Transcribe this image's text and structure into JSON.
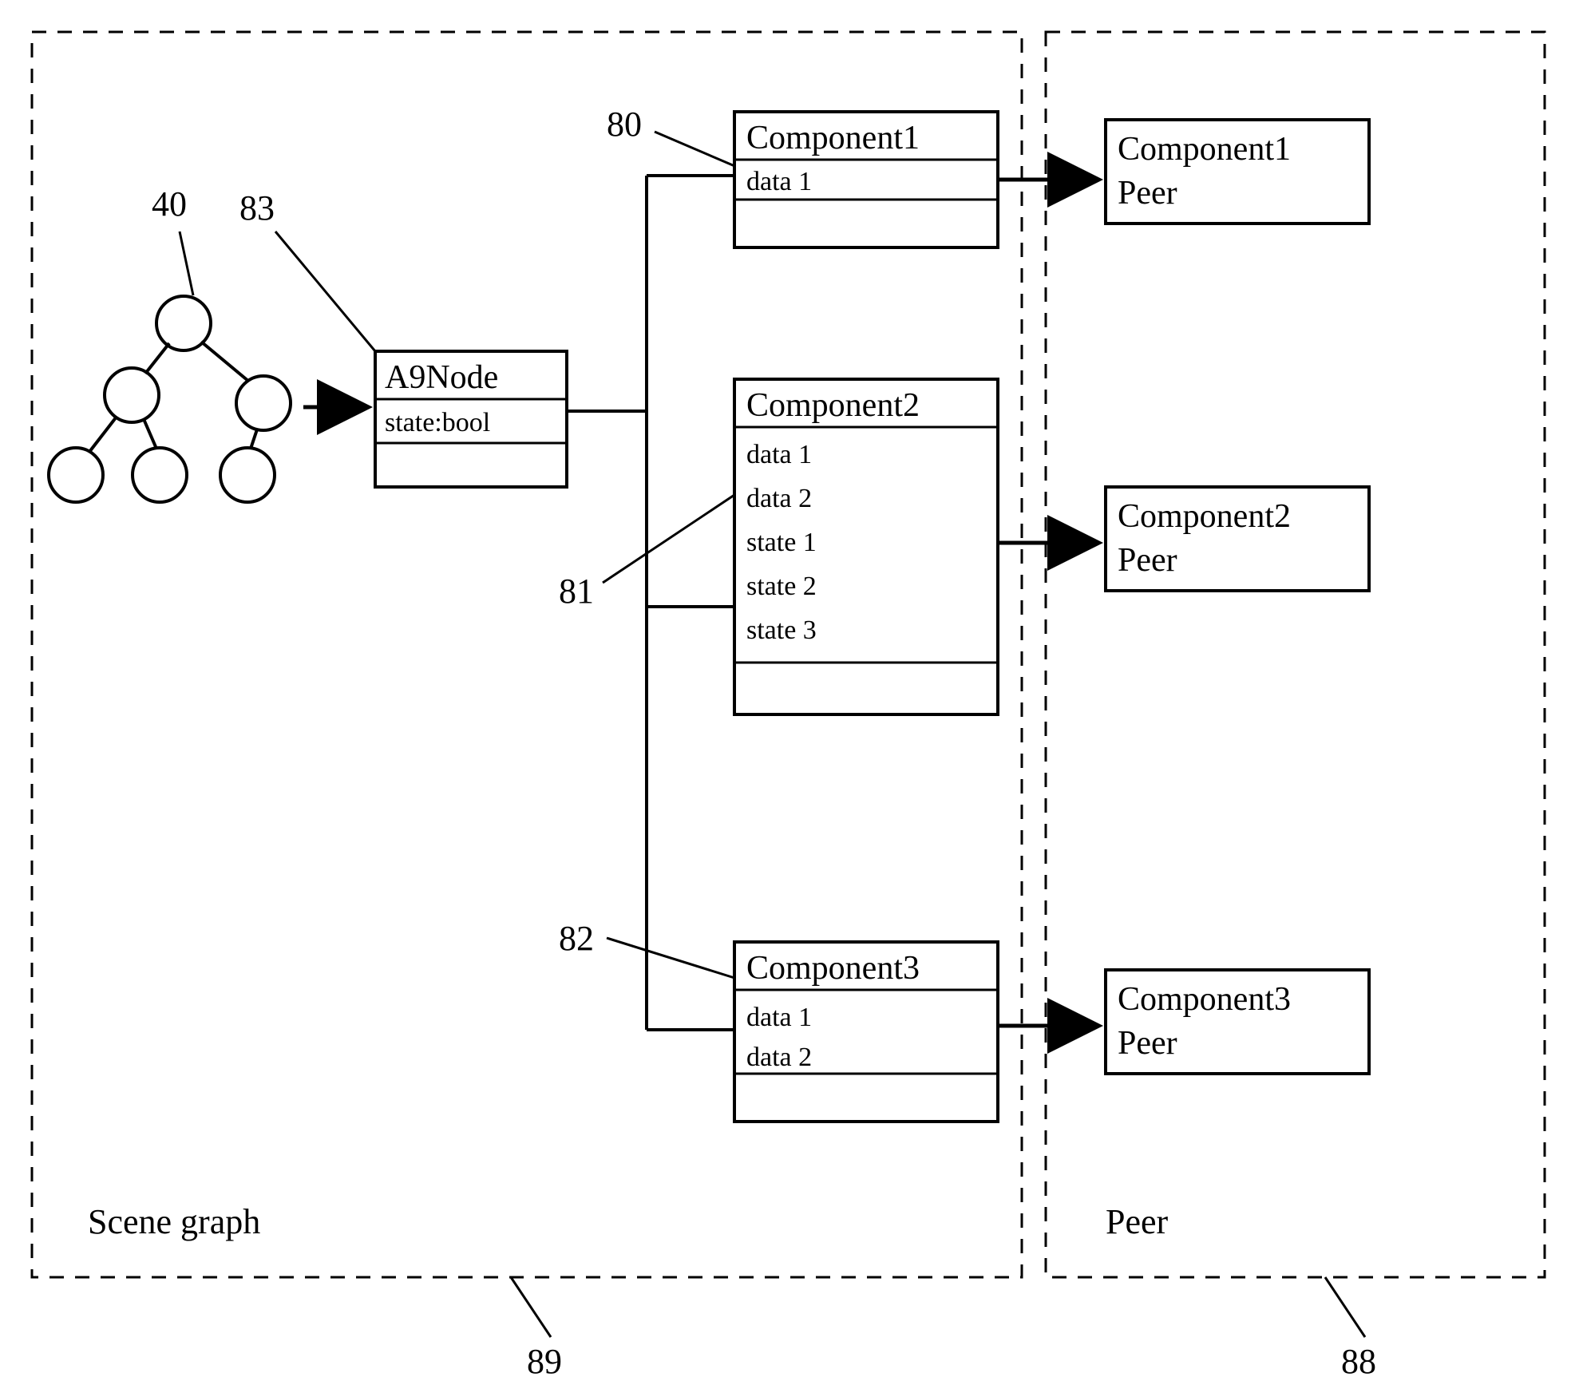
{
  "regions": {
    "scene_graph": {
      "label": "Scene graph",
      "ref": "89"
    },
    "peer": {
      "label": "Peer",
      "ref": "88"
    }
  },
  "tree_ref": "40",
  "node": {
    "ref": "83",
    "title": "A9Node",
    "field": "state:bool"
  },
  "components": [
    {
      "ref": "80",
      "title": "Component1",
      "items": [
        "data 1"
      ],
      "peer_lines": [
        "Component1",
        "Peer"
      ]
    },
    {
      "ref": "81",
      "title": "Component2",
      "items": [
        "data 1",
        "data 2",
        "state 1",
        "state 2",
        "state 3"
      ],
      "peer_lines": [
        "Component2",
        "Peer"
      ]
    },
    {
      "ref": "82",
      "title": "Component3",
      "items": [
        "data 1",
        "data 2"
      ],
      "peer_lines": [
        "Component3",
        "Peer"
      ]
    }
  ]
}
